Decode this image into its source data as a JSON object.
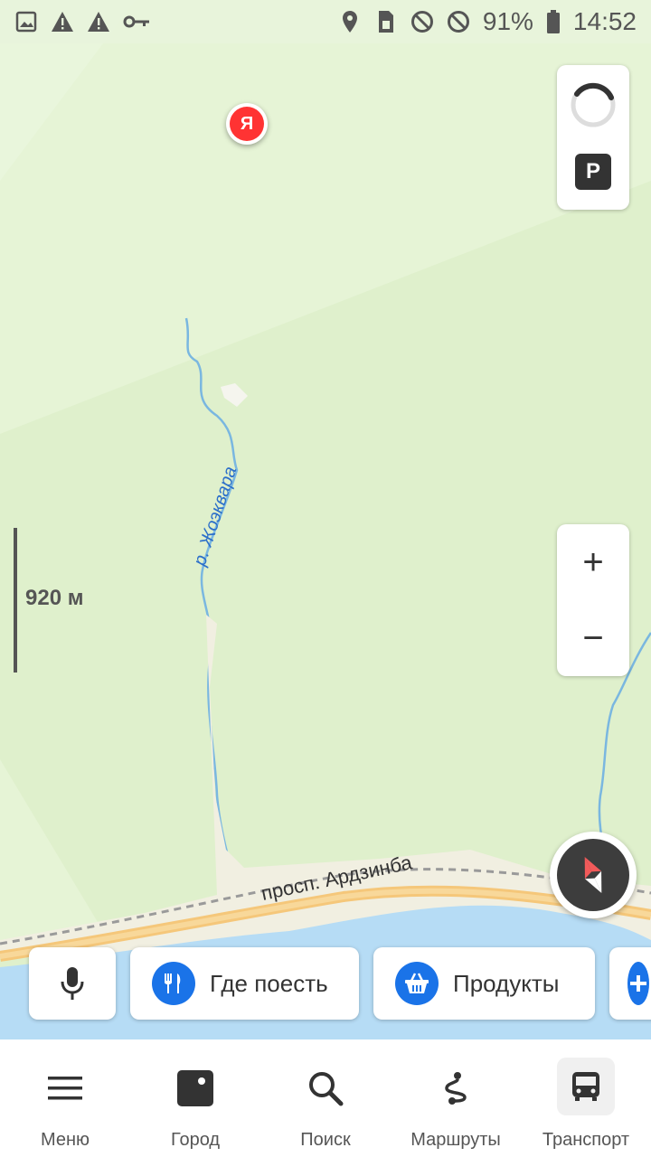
{
  "status_bar": {
    "battery": "91%",
    "time": "14:52",
    "left_icons": [
      "image-icon",
      "warning-icon",
      "warning-icon",
      "key-icon"
    ],
    "right_icons": [
      "location-icon",
      "sim-icon",
      "blocked-icon",
      "blocked-icon",
      "battery-icon"
    ]
  },
  "map": {
    "river_label": "р. Жоэквара",
    "road_label": "просп. Ардзинба",
    "scale_label": "920 м",
    "pin_letter": "Я",
    "parking_label": "P",
    "zoom_in": "+",
    "zoom_out": "−"
  },
  "chips": {
    "food": "Где поесть",
    "grocery": "Продукты"
  },
  "nav": {
    "items": [
      {
        "label": "Меню",
        "icon": "menu-icon"
      },
      {
        "label": "Город",
        "icon": "city-icon"
      },
      {
        "label": "Поиск",
        "icon": "search-icon"
      },
      {
        "label": "Маршруты",
        "icon": "route-icon"
      },
      {
        "label": "Транспорт",
        "icon": "bus-icon"
      }
    ]
  },
  "colors": {
    "map_bg": "#dff0cc",
    "map_light": "#e6f4d6",
    "water": "#b6dcf5",
    "road": "#f5c77a",
    "accent": "#1a73e8"
  }
}
